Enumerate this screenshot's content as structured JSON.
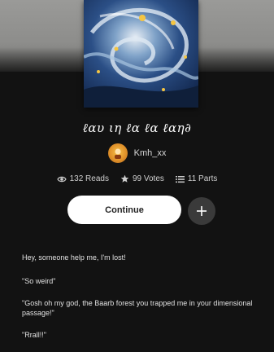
{
  "story": {
    "title": "ℓαυ ιη ℓα ℓα ℓαη∂",
    "author": "Kmh_xx",
    "reads": "132 Reads",
    "votes": "99 Votes",
    "parts": "11 Parts"
  },
  "actions": {
    "continue_label": "Continue"
  },
  "content": {
    "paragraphs": [
      "Hey, someone help me, I'm lost!",
      "\"So weird\"",
      "\"Gosh oh my god, the Baarb forest you trapped me in your dimensional passage!\"",
      "\"Rrall!!\""
    ]
  },
  "colors": {
    "background": "#121212",
    "button": "#ffffff",
    "add_button": "#3a3a3a"
  }
}
